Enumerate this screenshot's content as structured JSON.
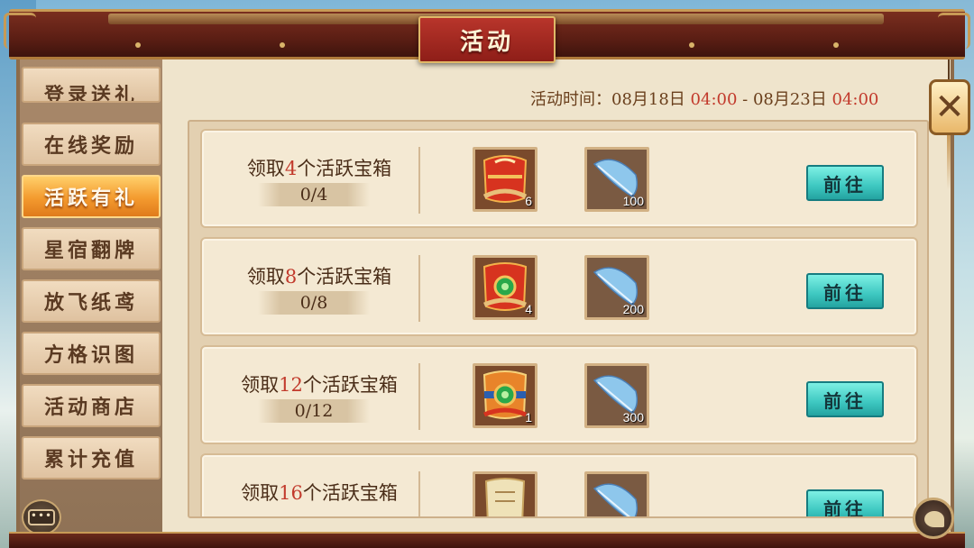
{
  "window": {
    "title": "活动"
  },
  "sidebar": {
    "tabs": [
      {
        "label": "登录送礼",
        "active": false
      },
      {
        "label": "在线奖励",
        "active": false
      },
      {
        "label": "活跃有礼",
        "active": true
      },
      {
        "label": "星宿翻牌",
        "active": false
      },
      {
        "label": "放飞纸鸢",
        "active": false
      },
      {
        "label": "方格识图",
        "active": false
      },
      {
        "label": "活动商店",
        "active": false
      },
      {
        "label": "累计充值",
        "active": false
      }
    ]
  },
  "event_time": {
    "label": "活动时间：",
    "start_date": "08月18日",
    "start_time": "04:00",
    "separator": " - ",
    "end_date": "08月23日",
    "end_time": "04:00"
  },
  "tasks": [
    {
      "prefix": "领取",
      "number": "4",
      "suffix": "个活跃宝箱",
      "progress": "0/4",
      "rewards": [
        {
          "icon": "red-pouch-icon",
          "count": "6"
        },
        {
          "icon": "blue-feather-icon",
          "count": "100"
        }
      ],
      "button": "前往"
    },
    {
      "prefix": "领取",
      "number": "8",
      "suffix": "个活跃宝箱",
      "progress": "0/8",
      "rewards": [
        {
          "icon": "red-jade-pouch-icon",
          "count": "4"
        },
        {
          "icon": "blue-feather-icon",
          "count": "200"
        }
      ],
      "button": "前往"
    },
    {
      "prefix": "领取",
      "number": "12",
      "suffix": "个活跃宝箱",
      "progress": "0/12",
      "rewards": [
        {
          "icon": "gold-jade-pouch-icon",
          "count": "1"
        },
        {
          "icon": "blue-feather-icon",
          "count": "300"
        }
      ],
      "button": "前往"
    },
    {
      "prefix": "领取",
      "number": "16",
      "suffix": "个活跃宝箱",
      "progress": "",
      "rewards": [
        {
          "icon": "scroll-pouch-icon",
          "count": ""
        },
        {
          "icon": "blue-feather-icon",
          "count": ""
        }
      ],
      "button": "前往"
    }
  ],
  "colors": {
    "frame_red": "#7a2e1f",
    "active_tab": "#f39a2e",
    "highlight_number": "#c23a2c",
    "go_button": "#3dc7c0",
    "panel_bg": "#efe4cc"
  },
  "icons": {
    "close": "close-icon",
    "chat": "chat-icon",
    "corner": "leaf-emblem-icon"
  },
  "chat_button_glyph": "•••",
  "close_glyph": "✕"
}
